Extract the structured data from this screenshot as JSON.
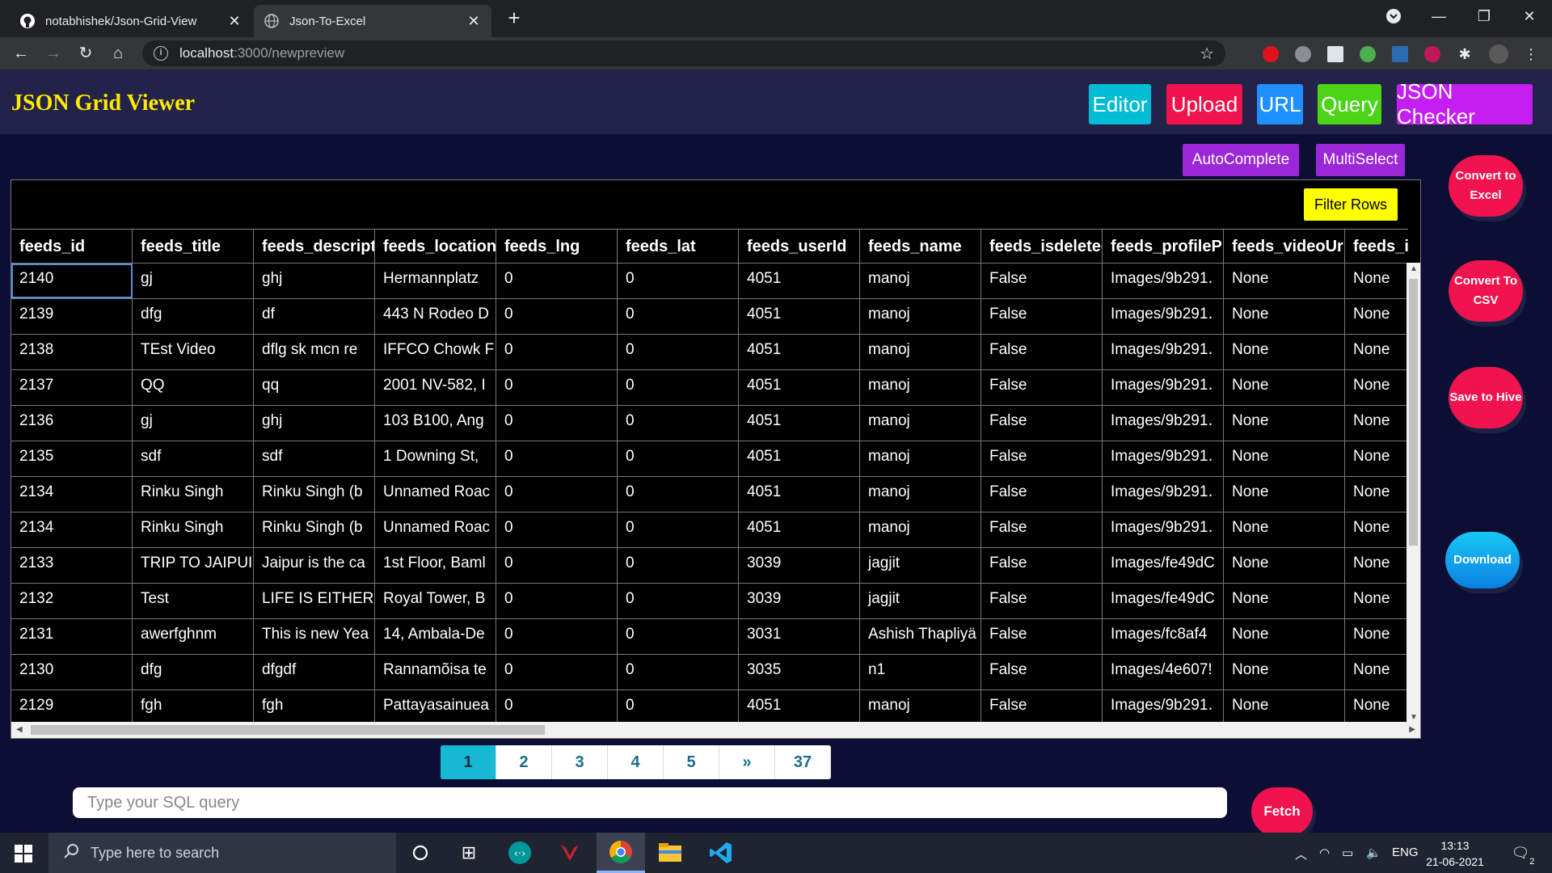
{
  "browser": {
    "tabs": [
      {
        "title": "notabhishek/Json-Grid-View",
        "active": false,
        "icon": "github-icon"
      },
      {
        "title": "Json-To-Excel",
        "active": true,
        "icon": "globe-icon"
      }
    ],
    "url_host": "localhost",
    "url_path": ":3000/newpreview"
  },
  "header": {
    "brand": "JSON Grid Viewer",
    "buttons": [
      {
        "label": "Editor",
        "color": "#00bcd4"
      },
      {
        "label": "Upload",
        "color": "#f0134d"
      },
      {
        "label": "URL",
        "color": "#1e90ff"
      },
      {
        "label": "Query",
        "color": "#4cd417"
      },
      {
        "label": "JSON Checker",
        "color": "#c51ef0"
      }
    ]
  },
  "toolbar": {
    "autocomplete": "AutoComplete",
    "multiselect": "MultiSelect",
    "filter_rows": "Filter Rows"
  },
  "grid": {
    "columns": [
      "feeds_id",
      "feeds_title",
      "feeds_descripti",
      "feeds_location",
      "feeds_lng",
      "feeds_lat",
      "feeds_userId",
      "feeds_name",
      "feeds_isdeletec",
      "feeds_profilePi",
      "feeds_videoUrl",
      "feeds_i"
    ],
    "rows": [
      [
        "2140",
        "gj",
        "ghj",
        "Hermannplatz",
        "0",
        "0",
        "4051",
        "manoj",
        "False",
        "Images/9b291․",
        "None",
        "None"
      ],
      [
        "2139",
        "dfg",
        "df",
        "443 N Rodeo D",
        "0",
        "0",
        "4051",
        "manoj",
        "False",
        "Images/9b291․",
        "None",
        "None"
      ],
      [
        "2138",
        "TEst Video",
        "dflg sk mcn re",
        "IFFCO Chowk F",
        "0",
        "0",
        "4051",
        "manoj",
        "False",
        "Images/9b291․",
        "None",
        "None"
      ],
      [
        "2137",
        "QQ",
        "qq",
        "2001 NV-582, I",
        "0",
        "0",
        "4051",
        "manoj",
        "False",
        "Images/9b291․",
        "None",
        "None"
      ],
      [
        "2136",
        "gj",
        "ghj",
        "103 B100, Ang",
        "0",
        "0",
        "4051",
        "manoj",
        "False",
        "Images/9b291․",
        "None",
        "None"
      ],
      [
        "2135",
        "sdf",
        "sdf",
        "1 Downing St, ",
        "0",
        "0",
        "4051",
        "manoj",
        "False",
        "Images/9b291․",
        "None",
        "None"
      ],
      [
        "2134",
        "Rinku Singh",
        "Rinku Singh (b",
        "Unnamed Roac",
        "0",
        "0",
        "4051",
        "manoj",
        "False",
        "Images/9b291․",
        "None",
        "None"
      ],
      [
        "2134",
        "Rinku Singh",
        "Rinku Singh (b",
        "Unnamed Roac",
        "0",
        "0",
        "4051",
        "manoj",
        "False",
        "Images/9b291․",
        "None",
        "None"
      ],
      [
        "2133",
        "TRIP TO JAIPUI",
        "Jaipur is the ca",
        "1st Floor, Baml",
        "0",
        "0",
        "3039",
        "jagjit",
        "False",
        "Images/fe49dC",
        "None",
        "None"
      ],
      [
        "2132",
        "Test",
        "LIFE IS EITHER",
        "Royal Tower, B",
        "0",
        "0",
        "3039",
        "jagjit",
        "False",
        "Images/fe49dC",
        "None",
        "None"
      ],
      [
        "2131",
        "awerfghnm",
        "This is new Yea",
        "14, Ambala-De",
        "0",
        "0",
        "3031",
        "Ashish Thapliyä",
        "False",
        "Images/fc8af4",
        "None",
        "None"
      ],
      [
        "2130",
        "dfg",
        "dfgdf",
        "Rannamõisa te",
        "0",
        "0",
        "3035",
        "n1",
        "False",
        "Images/4e607!",
        "None",
        "None"
      ],
      [
        "2129",
        "fgh",
        "fgh",
        "Pattayasainuea",
        "0",
        "0",
        "4051",
        "manoj",
        "False",
        "Images/9b291․",
        "None",
        "None"
      ]
    ]
  },
  "side_buttons": {
    "convert_excel": "Convert to Excel",
    "convert_csv": "Convert To CSV",
    "save_hive": "Save to Hive",
    "download": "Download"
  },
  "pagination": [
    "1",
    "2",
    "3",
    "4",
    "5",
    "»",
    "37"
  ],
  "pagination_active": "1",
  "query": {
    "placeholder": "Type your SQL query",
    "fetch": "Fetch"
  },
  "taskbar": {
    "search_placeholder": "Type here to search",
    "lang": "ENG",
    "time": "13:13",
    "date": "21-06-2021",
    "notification_count": "2"
  }
}
